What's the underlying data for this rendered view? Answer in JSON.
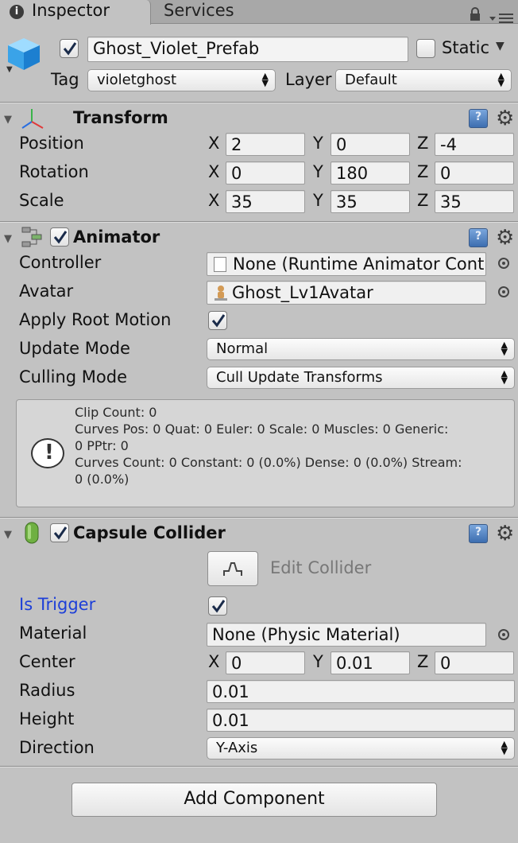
{
  "tabs": {
    "inspector": "Inspector",
    "services": "Services"
  },
  "header": {
    "object_name": "Ghost_Violet_Prefab",
    "active": true,
    "static_label": "Static",
    "static": false,
    "tag_label": "Tag",
    "tag_value": "violetghost",
    "layer_label": "Layer",
    "layer_value": "Default"
  },
  "transform": {
    "title": "Transform",
    "rows": [
      {
        "label": "Position",
        "x": "2",
        "y": "0",
        "z": "-4"
      },
      {
        "label": "Rotation",
        "x": "0",
        "y": "180",
        "z": "0"
      },
      {
        "label": "Scale",
        "x": "35",
        "y": "35",
        "z": "35"
      }
    ],
    "axes": {
      "x": "X",
      "y": "Y",
      "z": "Z"
    }
  },
  "animator": {
    "title": "Animator",
    "enabled": true,
    "controller_label": "Controller",
    "controller_value": "None (Runtime Animator Controller)",
    "avatar_label": "Avatar",
    "avatar_value": "Ghost_Lv1Avatar",
    "apply_root_motion_label": "Apply Root Motion",
    "apply_root_motion": true,
    "update_mode_label": "Update Mode",
    "update_mode_value": "Normal",
    "culling_mode_label": "Culling Mode",
    "culling_mode_value": "Cull Update Transforms",
    "info": [
      "Clip Count: 0",
      "Curves Pos: 0 Quat: 0 Euler: 0 Scale: 0 Muscles: 0 Generic:",
      "0 PPtr: 0",
      "Curves Count: 0 Constant: 0 (0.0%) Dense: 0 (0.0%) Stream:",
      "0 (0.0%)"
    ]
  },
  "capsule": {
    "title": "Capsule Collider",
    "enabled": true,
    "edit_collider_label": "Edit Collider",
    "is_trigger_label": "Is Trigger",
    "is_trigger": true,
    "material_label": "Material",
    "material_value": "None (Physic Material)",
    "center_label": "Center",
    "center": {
      "x": "0",
      "y": "0.01",
      "z": "0"
    },
    "radius_label": "Radius",
    "radius_value": "0.01",
    "height_label": "Height",
    "height_value": "0.01",
    "direction_label": "Direction",
    "direction_value": "Y-Axis"
  },
  "add_component_label": "Add Component"
}
